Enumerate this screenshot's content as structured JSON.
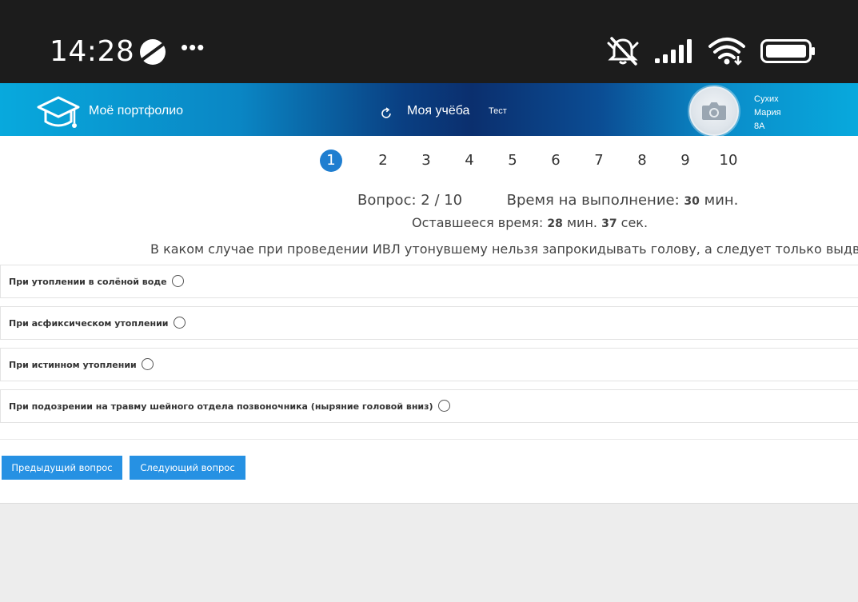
{
  "status_bar": {
    "time": "14:28",
    "dots": "•••",
    "icons": [
      "planet-icon",
      "bell-off-icon",
      "signal-icon",
      "wifi-icon",
      "battery-icon"
    ]
  },
  "header": {
    "portfolio_label": "Моё портфолио",
    "study_label": "Моя учёба",
    "test_label": "Тест",
    "user": {
      "last_name": "Сухих",
      "first_name": "Мария",
      "class": "8А"
    },
    "colors": {
      "header_start": "#08a9dd",
      "header_mid": "#0b2f6e"
    }
  },
  "pager": {
    "pages": [
      "1",
      "2",
      "3",
      "4",
      "5",
      "6",
      "7",
      "8",
      "9",
      "10"
    ],
    "active": "1"
  },
  "quiz": {
    "question_label": "Вопрос:",
    "question_progress": "2 / 10",
    "time_label": "Время на выполнение:",
    "time_value": "30",
    "min_label": "мин.",
    "remaining_label": "Оставшееся время:",
    "remaining_min": "28",
    "remaining_min_label": "мин.",
    "remaining_sec": "37",
    "remaining_sec_label": "сек.",
    "question_text": "В каком случае при проведении ИВЛ утонувшему нельзя запрокидывать голову, а следует только выдвигать нижнюю челюсть?",
    "answers": [
      "При утоплении в солёной воде",
      "При асфиксическом утоплении",
      "При истинном утоплении",
      "При подозрении на травму шейного отдела позвоночника (ныряние головой вниз)"
    ]
  },
  "buttons": {
    "prev_label": "Предыдущий вопрос",
    "next_label": "Следующий вопрос",
    "color": "#2691e3"
  }
}
